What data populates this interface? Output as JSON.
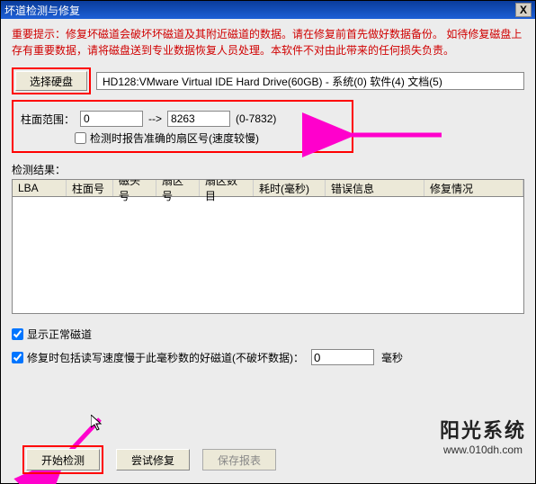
{
  "titlebar": {
    "title": "坏道检测与修复",
    "close_icon": "X"
  },
  "warning": "重要提示：修复坏磁道会破坏坏磁道及其附近磁道的数据。请在修复前首先做好数据备份。\n如待修复磁盘上存有重要数据，请将磁盘送到专业数据恢复人员处理。本软件不对由此带来的任何损失负责。",
  "select_disk_label": "选择硬盘",
  "disk_info": "HD128:VMware Virtual IDE Hard Drive(60GB) - 系统(0) 软件(4) 文档(5)",
  "range": {
    "label": "柱面范围：",
    "from_value": "0",
    "arrow": "-->",
    "to_value": "8263",
    "hint": "(0-7832)",
    "checkbox_label": "检测时报告准确的扇区号(速度较慢)",
    "checkbox_checked": false
  },
  "results_label": "检测结果：",
  "table": {
    "columns": [
      "LBA",
      "柱面号",
      "磁头号",
      "扇区号",
      "扇区数目",
      "耗时(毫秒)",
      "错误信息",
      "修复情况"
    ]
  },
  "options": {
    "show_normal": {
      "label": "显示正常磁道",
      "checked": true
    },
    "include_slow": {
      "label_prefix": "修复时包括读写速度慢于此毫秒数的好磁道(不破坏数据)：",
      "value": "0",
      "unit": "毫秒",
      "checked": true
    }
  },
  "buttons": {
    "start": "开始检测",
    "try_repair": "尝试修复",
    "save_report": "保存报表"
  },
  "watermark": {
    "big": "阳光系统",
    "small": "www.010dh.com"
  }
}
